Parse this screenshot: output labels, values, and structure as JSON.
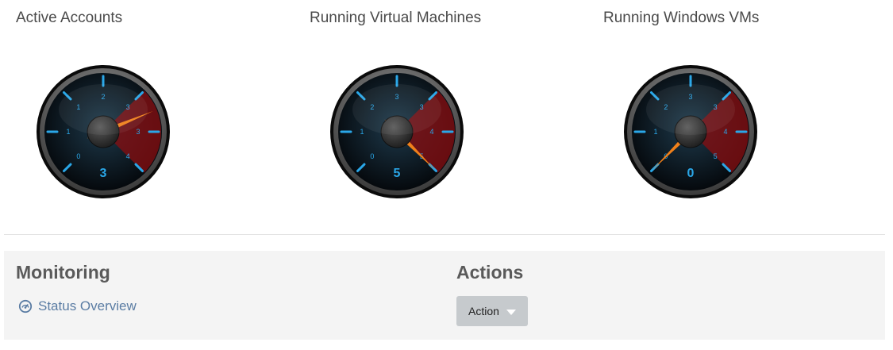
{
  "gauges": [
    {
      "title": "Active Accounts",
      "value": 3,
      "max": 4,
      "display": "3",
      "tick_labels": [
        "0",
        "1",
        "1",
        "2",
        "3",
        "3",
        "4"
      ]
    },
    {
      "title": "Running Virtual Machines",
      "value": 5,
      "max": 5,
      "display": "5",
      "tick_labels": [
        "0",
        "1",
        "2",
        "3",
        "3",
        "4",
        "5"
      ]
    },
    {
      "title": "Running Windows VMs",
      "value": 0,
      "max": 5,
      "display": "0",
      "tick_labels": [
        "0",
        "1",
        "2",
        "3",
        "3",
        "4",
        "5"
      ]
    }
  ],
  "monitoring": {
    "title": "Monitoring",
    "status_link": "Status Overview",
    "icon": "dashboard-icon"
  },
  "actions": {
    "title": "Actions",
    "button_label": "Action",
    "icon": "caret-down-icon"
  },
  "colors": {
    "needle": "#f0801a",
    "tick": "#2aa7e8",
    "danger_zone": "#8a0d10",
    "link": "#5a7ca3",
    "panel_bg": "#f4f4f4"
  }
}
